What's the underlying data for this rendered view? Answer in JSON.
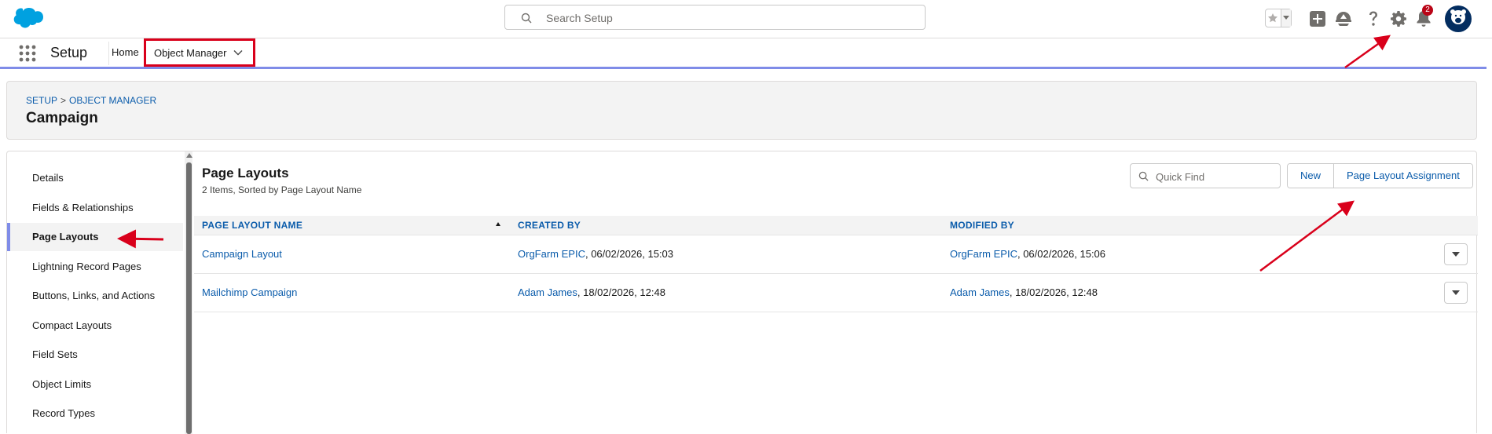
{
  "header": {
    "search_placeholder": "Search Setup",
    "notification_count": "2"
  },
  "context_bar": {
    "app_name": "Setup",
    "tabs": [
      {
        "label": "Home"
      },
      {
        "label": "Object Manager"
      }
    ]
  },
  "page_header": {
    "breadcrumb": [
      "SETUP",
      ">",
      "OBJECT MANAGER"
    ],
    "title": "Campaign"
  },
  "left_nav": {
    "items": [
      {
        "label": "Details"
      },
      {
        "label": "Fields & Relationships"
      },
      {
        "label": "Page Layouts",
        "active": true
      },
      {
        "label": "Lightning Record Pages"
      },
      {
        "label": "Buttons, Links, and Actions"
      },
      {
        "label": "Compact Layouts"
      },
      {
        "label": "Field Sets"
      },
      {
        "label": "Object Limits"
      },
      {
        "label": "Record Types"
      }
    ]
  },
  "main": {
    "title": "Page Layouts",
    "subtitle": "2 Items, Sorted by Page Layout Name",
    "quick_find_placeholder": "Quick Find",
    "buttons": {
      "new": "New",
      "assignment": "Page Layout Assignment"
    },
    "columns": [
      "PAGE LAYOUT NAME",
      "CREATED BY",
      "MODIFIED BY"
    ],
    "rows": [
      {
        "name": "Campaign Layout",
        "created_user": "OrgFarm EPIC",
        "created_date": ", 06/02/2026, 15:03",
        "modified_user": "OrgFarm EPIC",
        "modified_date": ", 06/02/2026, 15:06"
      },
      {
        "name": "Mailchimp Campaign",
        "created_user": "Adam James",
        "created_date": ", 18/02/2026, 12:48",
        "modified_user": "Adam James",
        "modified_date": ", 18/02/2026, 12:48"
      }
    ]
  },
  "colors": {
    "brand_blue": "#0b5cab",
    "accent_bar": "#7f8ce8",
    "annotation_red": "#d9001b",
    "salesforce_cloud": "#00a1e0"
  }
}
